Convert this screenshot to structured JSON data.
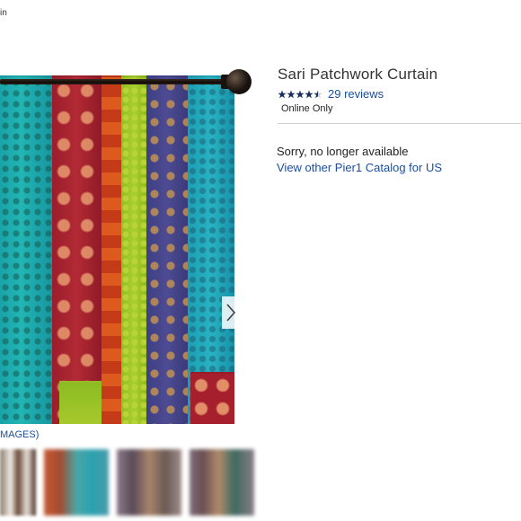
{
  "breadcrumb": {
    "text": "in"
  },
  "product": {
    "title": "Sari Patchwork Curtain",
    "rating_value": 4.5,
    "rating_max": 5,
    "reviews_label": "29 reviews",
    "availability_note": "Online Only",
    "unavailable_message": "Sorry, no longer available",
    "catalog_link": "View other Pier1 Catalog for US"
  },
  "gallery": {
    "images_label": "MAGES)",
    "next_icon": "chevron-right-icon",
    "thumbnail_count": 4
  },
  "colors": {
    "link": "#1a4fa0",
    "star": "#1c2f5e",
    "divider": "#cfcfcf"
  }
}
